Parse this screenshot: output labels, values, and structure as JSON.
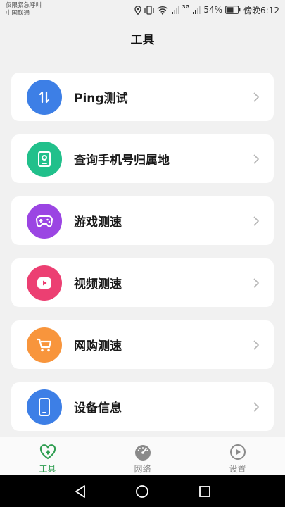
{
  "status_bar": {
    "carrier_line1": "仅限紧急呼叫",
    "carrier_line2": "中国联通",
    "signal_badge": "3G",
    "battery_percent": "54%",
    "time": "傍晚6:12"
  },
  "header": {
    "title": "工具"
  },
  "colors": {
    "ping": "#3d7fe6",
    "phone": "#21c08b",
    "game": "#9b45e3",
    "video": "#ec3f72",
    "shop": "#f8953c",
    "device": "#3d7fe6",
    "tab_active": "#2e9d50",
    "tab_inactive": "#8a8a8a"
  },
  "tools": [
    {
      "label": "Ping测试",
      "icon": "updown-arrows-icon"
    },
    {
      "label": "查询手机号归属地",
      "icon": "contact-card-icon"
    },
    {
      "label": "游戏测速",
      "icon": "gamepad-icon"
    },
    {
      "label": "视频测速",
      "icon": "play-icon"
    },
    {
      "label": "网购测速",
      "icon": "cart-icon"
    },
    {
      "label": "设备信息",
      "icon": "smartphone-icon"
    }
  ],
  "tabs": [
    {
      "label": "工具",
      "icon": "heart-plus-icon",
      "active": true
    },
    {
      "label": "网络",
      "icon": "speedometer-icon",
      "active": false
    },
    {
      "label": "设置",
      "icon": "play-circle-icon",
      "active": false
    }
  ],
  "nav": [
    "back-icon",
    "home-icon",
    "recents-icon"
  ]
}
